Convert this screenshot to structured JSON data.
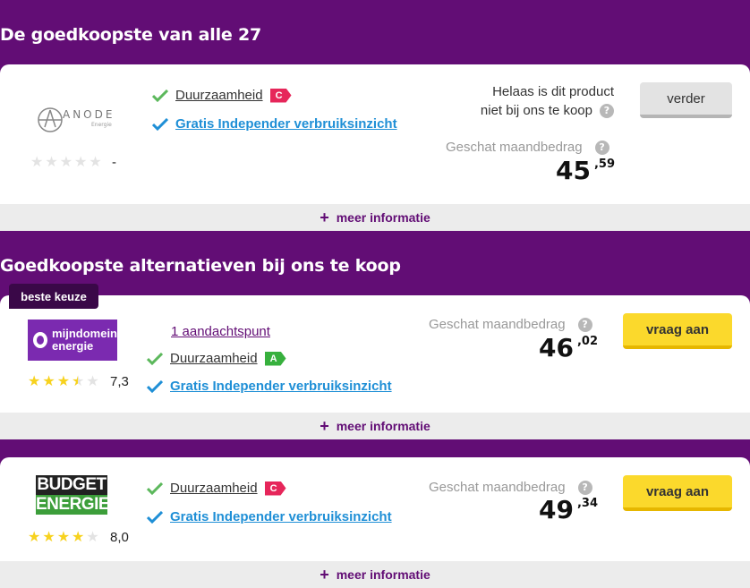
{
  "sections": {
    "cheapest_title": "De goedkoopste van alle 27",
    "alternatives_title": "Goedkoopste alternatieven bij ons te koop"
  },
  "common": {
    "sustainability_label": "Duurzaamheid",
    "insight_label": "Gratis Independer verbruiksinzicht",
    "estimated_label": "Geschat maandbedrag",
    "more_info_label": "meer informatie",
    "question_mark": "?",
    "plus": "+"
  },
  "cards": [
    {
      "provider": "ANODE",
      "provider_sub": "Energie",
      "rating": "-",
      "stars_value": 0,
      "sustainability_grade": "C",
      "not_for_sale_line1": "Helaas is dit product",
      "not_for_sale_line2": "niet bij ons te koop",
      "price_euros": "45",
      "price_cents": ",59",
      "button_label": "verder"
    },
    {
      "badge": "beste keuze",
      "provider_line1": "mijndomein",
      "provider_line2": "energie",
      "rating": "7,3",
      "stars_value": 3.5,
      "attention_label": "1 aandachtspunt",
      "sustainability_grade": "A",
      "price_euros": "46",
      "price_cents": ",02",
      "button_label": "vraag aan"
    },
    {
      "provider_line1": "BUDGET",
      "provider_line2": "ENERGIE",
      "rating": "8,0",
      "stars_value": 4,
      "sustainability_grade": "C",
      "price_euros": "49",
      "price_cents": ",34",
      "button_label": "vraag aan"
    }
  ],
  "colors": {
    "brand_purple": "#620d75",
    "check_green": "#5cb85c",
    "check_blue": "#1f8fd6",
    "cta_yellow": "#fbd92c",
    "grade_c": "#e6265a",
    "grade_a": "#37b03d"
  }
}
